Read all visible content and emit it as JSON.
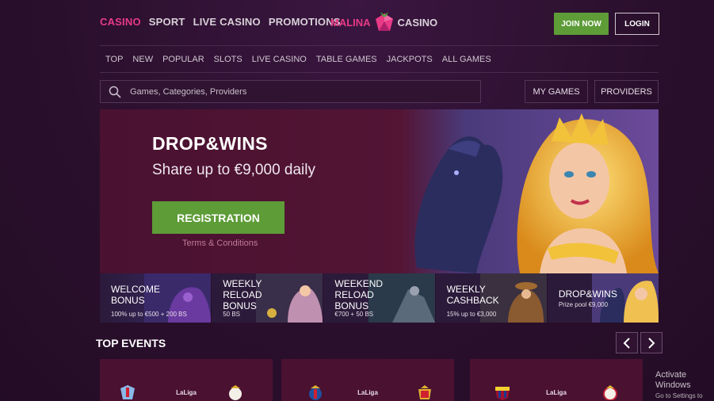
{
  "top_nav": [
    {
      "label": "CASINO",
      "active": true
    },
    {
      "label": "SPORT",
      "active": false
    },
    {
      "label": "LIVE CASINO",
      "active": false
    },
    {
      "label": "PROMOTIONS",
      "active": false
    }
  ],
  "logo": {
    "part1": "MALINA",
    "part2": "CASINO"
  },
  "auth": {
    "join": "JOIN NOW",
    "login": "LOGIN"
  },
  "sub_nav": [
    "TOP",
    "NEW",
    "POPULAR",
    "SLOTS",
    "LIVE CASINO",
    "TABLE GAMES",
    "JACKPOTS",
    "ALL GAMES"
  ],
  "search": {
    "placeholder": "Games, Categories, Providers"
  },
  "filters": {
    "my_games": "MY GAMES",
    "providers": "PROVIDERS"
  },
  "hero": {
    "title": "DROP&WINS",
    "subtitle": "Share up to €9,000 daily",
    "cta": "REGISTRATION",
    "terms": "Terms & Conditions"
  },
  "promos": [
    {
      "title": "WELCOME\nBONUS",
      "sub": "100% up to €500 + 200 BS"
    },
    {
      "title": "WEEKLY\nRELOAD\nBONUS",
      "sub": "50 BS"
    },
    {
      "title": "WEEKEND\nRELOAD\nBONUS",
      "sub": "€700 + 50 BS"
    },
    {
      "title": "WEEKLY\nCASHBACK",
      "sub": "15% up to €3,000"
    },
    {
      "title": "DROP&WINS",
      "sub": "Prize pool €9,000"
    }
  ],
  "events": {
    "title": "TOP EVENTS",
    "cards": [
      {
        "league": "LaLiga"
      },
      {
        "league": "LaLiga"
      },
      {
        "league": "LaLiga"
      }
    ]
  },
  "watermark": {
    "line1": "Activate Windows",
    "line2": "Go to Settings to activate Windows."
  },
  "colors": {
    "accent": "#e83a86",
    "green": "#5e9c38",
    "bg": "#2a0f2c",
    "hero": "#4b1230"
  }
}
